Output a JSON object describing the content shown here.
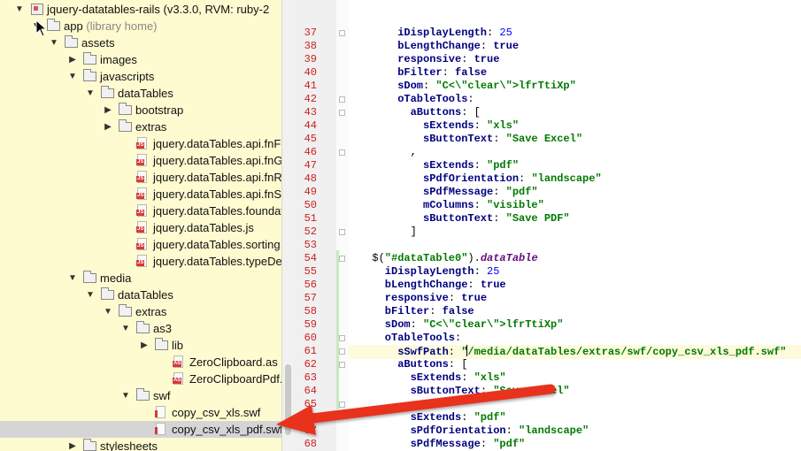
{
  "tree": {
    "items": [
      {
        "label": "jquery-datatables-rails (v3.3.0, RVM: ruby-2",
        "hint": "",
        "type": "module",
        "depth": 0,
        "arrow": "down"
      },
      {
        "label": "app",
        "hint": "(library home)",
        "type": "folder",
        "depth": 1,
        "arrow": "down"
      },
      {
        "label": "assets",
        "hint": "",
        "type": "folder",
        "depth": 2,
        "arrow": "down"
      },
      {
        "label": "images",
        "hint": "",
        "type": "folder",
        "depth": 3,
        "arrow": "right"
      },
      {
        "label": "javascripts",
        "hint": "",
        "type": "folder",
        "depth": 3,
        "arrow": "down"
      },
      {
        "label": "dataTables",
        "hint": "",
        "type": "folder",
        "depth": 4,
        "arrow": "down"
      },
      {
        "label": "bootstrap",
        "hint": "",
        "type": "folder",
        "depth": 5,
        "arrow": "right"
      },
      {
        "label": "extras",
        "hint": "",
        "type": "folder",
        "depth": 5,
        "arrow": "right"
      },
      {
        "label": "jquery.dataTables.api.fnFilte",
        "hint": "",
        "type": "js",
        "depth": 6,
        "arrow": ""
      },
      {
        "label": "jquery.dataTables.api.fnGet",
        "hint": "",
        "type": "js",
        "depth": 6,
        "arrow": ""
      },
      {
        "label": "jquery.dataTables.api.fnRelo",
        "hint": "",
        "type": "js",
        "depth": 6,
        "arrow": ""
      },
      {
        "label": "jquery.dataTables.api.fnSetF",
        "hint": "",
        "type": "js",
        "depth": 6,
        "arrow": ""
      },
      {
        "label": "jquery.dataTables.foundatio",
        "hint": "",
        "type": "js",
        "depth": 6,
        "arrow": ""
      },
      {
        "label": "jquery.dataTables.js",
        "hint": "",
        "type": "js",
        "depth": 6,
        "arrow": ""
      },
      {
        "label": "jquery.dataTables.sorting.nu",
        "hint": "",
        "type": "js",
        "depth": 6,
        "arrow": ""
      },
      {
        "label": "jquery.dataTables.typeDete",
        "hint": "",
        "type": "js",
        "depth": 6,
        "arrow": ""
      },
      {
        "label": "media",
        "hint": "",
        "type": "folder",
        "depth": 3,
        "arrow": "down"
      },
      {
        "label": "dataTables",
        "hint": "",
        "type": "folder",
        "depth": 4,
        "arrow": "down"
      },
      {
        "label": "extras",
        "hint": "",
        "type": "folder",
        "depth": 5,
        "arrow": "down"
      },
      {
        "label": "as3",
        "hint": "",
        "type": "folder",
        "depth": 6,
        "arrow": "down"
      },
      {
        "label": "lib",
        "hint": "",
        "type": "folder",
        "depth": 7,
        "arrow": "right"
      },
      {
        "label": "ZeroClipboard.as",
        "hint": "",
        "type": "as",
        "depth": 8,
        "arrow": ""
      },
      {
        "label": "ZeroClipboardPdf.as",
        "hint": "",
        "type": "as",
        "depth": 8,
        "arrow": ""
      },
      {
        "label": "swf",
        "hint": "",
        "type": "folder",
        "depth": 6,
        "arrow": "down"
      },
      {
        "label": "copy_csv_xls.swf",
        "hint": "",
        "type": "swf",
        "depth": 7,
        "arrow": ""
      },
      {
        "label": "copy_csv_xls_pdf.swf",
        "hint": "",
        "type": "swf",
        "depth": 7,
        "arrow": "",
        "selected": true
      },
      {
        "label": "stylesheets",
        "hint": "",
        "type": "folder",
        "depth": 3,
        "arrow": "right"
      }
    ]
  },
  "editor": {
    "lines": [
      {
        "n": "37",
        "t": [
          [
            "k",
            "iDisplayLength"
          ],
          [
            "p",
            ": "
          ],
          [
            "n",
            "25"
          ]
        ],
        "i": 6
      },
      {
        "n": "38",
        "t": [
          [
            "k",
            "bLengthChange"
          ],
          [
            "p",
            ": "
          ],
          [
            "k",
            "true"
          ]
        ],
        "i": 6
      },
      {
        "n": "39",
        "t": [
          [
            "k",
            "responsive"
          ],
          [
            "p",
            ": "
          ],
          [
            "k",
            "true"
          ]
        ],
        "i": 6
      },
      {
        "n": "40",
        "t": [
          [
            "k",
            "bFilter"
          ],
          [
            "p",
            ": "
          ],
          [
            "k",
            "false"
          ]
        ],
        "i": 6
      },
      {
        "n": "41",
        "t": [
          [
            "k",
            "sDom"
          ],
          [
            "p",
            ": "
          ],
          [
            "s",
            "\"C<\\\"clear\\\">lfrTtiXp\""
          ]
        ],
        "i": 6
      },
      {
        "n": "42",
        "t": [
          [
            "k",
            "oTableTools"
          ],
          [
            "p",
            ":"
          ]
        ],
        "i": 6
      },
      {
        "n": "43",
        "t": [
          [
            "k",
            "aButtons"
          ],
          [
            "p",
            ": ["
          ]
        ],
        "i": 8
      },
      {
        "n": "44",
        "t": [
          [
            "k",
            "sExtends"
          ],
          [
            "p",
            ": "
          ],
          [
            "s",
            "\"xls\""
          ]
        ],
        "i": 10
      },
      {
        "n": "45",
        "t": [
          [
            "k",
            "sButtonText"
          ],
          [
            "p",
            ": "
          ],
          [
            "s",
            "\"Save Excel\""
          ]
        ],
        "i": 10
      },
      {
        "n": "46",
        "t": [
          [
            "p",
            ","
          ]
        ],
        "i": 8
      },
      {
        "n": "47",
        "t": [
          [
            "k",
            "sExtends"
          ],
          [
            "p",
            ": "
          ],
          [
            "s",
            "\"pdf\""
          ]
        ],
        "i": 10
      },
      {
        "n": "48",
        "t": [
          [
            "k",
            "sPdfOrientation"
          ],
          [
            "p",
            ": "
          ],
          [
            "s",
            "\"landscape\""
          ]
        ],
        "i": 10
      },
      {
        "n": "49",
        "t": [
          [
            "k",
            "sPdfMessage"
          ],
          [
            "p",
            ": "
          ],
          [
            "s",
            "\"pdf\""
          ]
        ],
        "i": 10
      },
      {
        "n": "50",
        "t": [
          [
            "k",
            "mColumns"
          ],
          [
            "p",
            ": "
          ],
          [
            "s",
            "\"visible\""
          ]
        ],
        "i": 10
      },
      {
        "n": "51",
        "t": [
          [
            "k",
            "sButtonText"
          ],
          [
            "p",
            ": "
          ],
          [
            "s",
            "\"Save PDF\""
          ]
        ],
        "i": 10
      },
      {
        "n": "52",
        "t": [
          [
            "p",
            "]"
          ]
        ],
        "i": 8
      },
      {
        "n": "53",
        "t": [],
        "i": 0
      },
      {
        "n": "54",
        "t": [
          [
            "p",
            "$("
          ],
          [
            "s",
            "\"#dataTable0\""
          ],
          [
            "p",
            ")."
          ],
          [
            "f",
            "dataTable"
          ]
        ],
        "i": 2
      },
      {
        "n": "55",
        "t": [
          [
            "k",
            "iDisplayLength"
          ],
          [
            "p",
            ": "
          ],
          [
            "n",
            "25"
          ]
        ],
        "i": 4
      },
      {
        "n": "56",
        "t": [
          [
            "k",
            "bLengthChange"
          ],
          [
            "p",
            ": "
          ],
          [
            "k",
            "true"
          ]
        ],
        "i": 4
      },
      {
        "n": "57",
        "t": [
          [
            "k",
            "responsive"
          ],
          [
            "p",
            ": "
          ],
          [
            "k",
            "true"
          ]
        ],
        "i": 4
      },
      {
        "n": "58",
        "t": [
          [
            "k",
            "bFilter"
          ],
          [
            "p",
            ": "
          ],
          [
            "k",
            "false"
          ]
        ],
        "i": 4
      },
      {
        "n": "59",
        "t": [
          [
            "k",
            "sDom"
          ],
          [
            "p",
            ": "
          ],
          [
            "s",
            "\"C<\\\"clear\\\">lfrTtiXp\""
          ]
        ],
        "i": 4
      },
      {
        "n": "60",
        "t": [
          [
            "k",
            "oTableTools"
          ],
          [
            "p",
            ":"
          ]
        ],
        "i": 4
      },
      {
        "n": "61",
        "t": [
          [
            "k",
            "sSwfPath"
          ],
          [
            "p",
            ": "
          ],
          [
            "s",
            "\""
          ],
          [
            "c",
            ""
          ],
          [
            "s",
            "/media/dataTables/extras/swf/copy_csv_xls_pdf.swf\""
          ]
        ],
        "i": 6,
        "hl": true
      },
      {
        "n": "62",
        "t": [
          [
            "k",
            "aButtons"
          ],
          [
            "p",
            ": ["
          ]
        ],
        "i": 6
      },
      {
        "n": "63",
        "t": [
          [
            "k",
            "sExtends"
          ],
          [
            "p",
            ": "
          ],
          [
            "s",
            "\"xls\""
          ]
        ],
        "i": 8
      },
      {
        "n": "64",
        "t": [
          [
            "k",
            "sButtonText"
          ],
          [
            "p",
            ": "
          ],
          [
            "s",
            "\"Save Excel\""
          ]
        ],
        "i": 8
      },
      {
        "n": "65",
        "t": [
          [
            "p",
            ","
          ]
        ],
        "i": 6
      },
      {
        "n": "66",
        "t": [
          [
            "k",
            "sExtends"
          ],
          [
            "p",
            ": "
          ],
          [
            "s",
            "\"pdf\""
          ]
        ],
        "i": 8
      },
      {
        "n": "67",
        "t": [
          [
            "k",
            "sPdfOrientation"
          ],
          [
            "p",
            ": "
          ],
          [
            "s",
            "\"landscape\""
          ]
        ],
        "i": 8
      },
      {
        "n": "68",
        "t": [
          [
            "k",
            "sPdfMessage"
          ],
          [
            "p",
            ": "
          ],
          [
            "s",
            "\"pdf\""
          ]
        ],
        "i": 8
      }
    ]
  },
  "colors": {
    "arrow": "#e8321e",
    "line_number": "#cc1f1f",
    "tree_bg": "#fefbd0",
    "selection": "#d5d5d5"
  },
  "icons": {
    "folder": "folder-icon",
    "js": "js-file-icon",
    "as": "as-file-icon",
    "swf": "swf-file-icon",
    "module": "module-icon"
  }
}
